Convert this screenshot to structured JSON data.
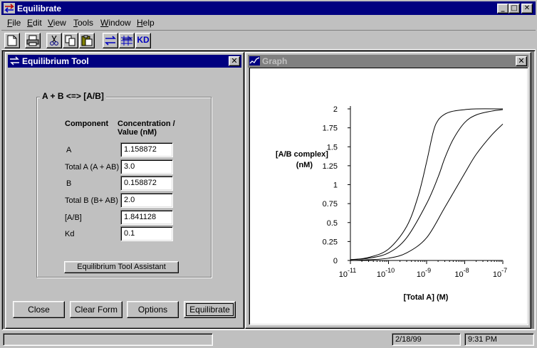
{
  "app": {
    "title": "Equilibrate"
  },
  "menu": [
    "File",
    "Edit",
    "View",
    "Tools",
    "Window",
    "Help"
  ],
  "toolbar": {
    "icons": [
      "new-file-icon",
      "print-icon",
      "cut-icon",
      "copy-icon",
      "paste-icon",
      "equilibrate-icon",
      "equilibrium-tool-icon",
      "kd-icon"
    ],
    "kd_label": "KD"
  },
  "tool_window": {
    "title": "Equilibrium Tool",
    "equation": "A + B <=> [A/B]",
    "col_component": "Component",
    "col_value_line1": "Concentration /",
    "col_value_line2": "Value (nM)",
    "rows": [
      {
        "label": "A",
        "value": "1.158872"
      },
      {
        "label": "Total A (A + AB)",
        "value": "3.0"
      },
      {
        "label": "B",
        "value": "0.158872"
      },
      {
        "label": "Total B (B+ AB)",
        "value": "2.0"
      },
      {
        "label": "[A/B]",
        "value": "1.841128"
      },
      {
        "label": "Kd",
        "value": "0.1"
      }
    ],
    "assistant_button": "Equilibrium Tool Assistant",
    "buttons": {
      "close": "Close",
      "clear": "Clear Form",
      "options": "Options",
      "equilibrate": "Equilibrate"
    }
  },
  "graph_window": {
    "title": "Graph",
    "accent": "#808080"
  },
  "chart_data": {
    "type": "line",
    "ylabel_line1": "[A/B complex]",
    "ylabel_line2": "(nM)",
    "xlabel": "[Total A] (M)",
    "x_scale": "log",
    "x_ticks": [
      {
        "base": "10",
        "exp": "-11"
      },
      {
        "base": "10",
        "exp": "-10"
      },
      {
        "base": "10",
        "exp": "-9"
      },
      {
        "base": "10",
        "exp": "-8"
      },
      {
        "base": "10",
        "exp": "-7"
      }
    ],
    "xlim": [
      1e-11,
      1e-07
    ],
    "y_ticks": [
      "0",
      "0.25",
      "0.5",
      "0.75",
      "1",
      "1.25",
      "1.5",
      "1.75",
      "2"
    ],
    "ylim": [
      0,
      2
    ],
    "series": [
      {
        "x": [
          1e-11,
          3e-11,
          1e-10,
          3e-10,
          6e-10,
          1e-09,
          1.5e-09,
          2e-09,
          3e-09,
          5e-09,
          1e-08,
          2e-08,
          1e-07
        ],
        "y": [
          0.01,
          0.04,
          0.15,
          0.45,
          0.85,
          1.3,
          1.7,
          1.85,
          1.93,
          1.97,
          1.99,
          2.0,
          2.0
        ]
      },
      {
        "x": [
          1e-11,
          3e-11,
          1e-10,
          3e-10,
          1e-09,
          2e-09,
          3e-09,
          5e-09,
          1e-08,
          2e-08,
          5e-08,
          1e-07
        ],
        "y": [
          0.01,
          0.03,
          0.1,
          0.3,
          0.75,
          1.1,
          1.35,
          1.6,
          1.82,
          1.92,
          1.97,
          1.99
        ]
      },
      {
        "x": [
          1e-11,
          3e-11,
          1e-10,
          3e-10,
          1e-09,
          3e-09,
          1e-08,
          2e-08,
          5e-08,
          1e-07
        ],
        "y": [
          0.0,
          0.01,
          0.03,
          0.1,
          0.3,
          0.7,
          1.15,
          1.4,
          1.65,
          1.8
        ]
      }
    ]
  },
  "status": {
    "left": "",
    "date": "2/18/99",
    "time": "9:31 PM"
  }
}
